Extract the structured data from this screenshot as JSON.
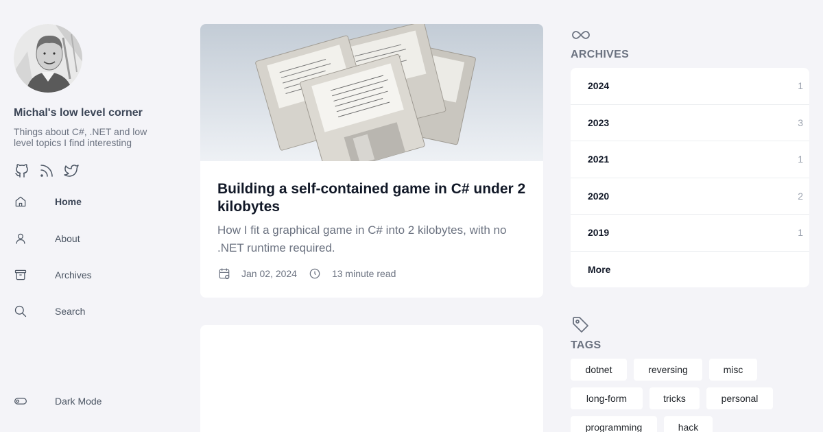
{
  "site": {
    "title": "Michal's low level corner",
    "description": "Things about C#, .NET and low level topics I find interesting"
  },
  "socials": [
    {
      "icon": "github-icon"
    },
    {
      "icon": "rss-icon"
    },
    {
      "icon": "twitter-icon"
    }
  ],
  "nav": {
    "items": [
      {
        "label": "Home",
        "icon": "home-icon",
        "active": true
      },
      {
        "label": "About",
        "icon": "user-icon",
        "active": false
      },
      {
        "label": "Archives",
        "icon": "archive-icon",
        "active": false
      },
      {
        "label": "Search",
        "icon": "search-icon",
        "active": false
      }
    ],
    "dark_mode": "Dark Mode"
  },
  "featured_post": {
    "title": "Building a self-contained game in C# under 2 kilobytes",
    "summary": "How I fit a graphical game in C# into 2 kilobytes, with no .NET runtime required.",
    "date": "Jan 02, 2024",
    "read_time": "13 minute read",
    "image": "floppy-disks"
  },
  "archives": {
    "heading": "ARCHIVES",
    "rows": [
      {
        "year": "2024",
        "count": "1"
      },
      {
        "year": "2023",
        "count": "3"
      },
      {
        "year": "2021",
        "count": "1"
      },
      {
        "year": "2020",
        "count": "2"
      },
      {
        "year": "2019",
        "count": "1"
      }
    ],
    "more": "More"
  },
  "tags": {
    "heading": "TAGS",
    "items": [
      "dotnet",
      "reversing",
      "misc",
      "long-form",
      "tricks",
      "personal",
      "programming",
      "hack"
    ]
  },
  "colors": {
    "background": "#f4f4f8",
    "card": "#ffffff",
    "text": "#1f2328",
    "muted": "#6b7280"
  }
}
